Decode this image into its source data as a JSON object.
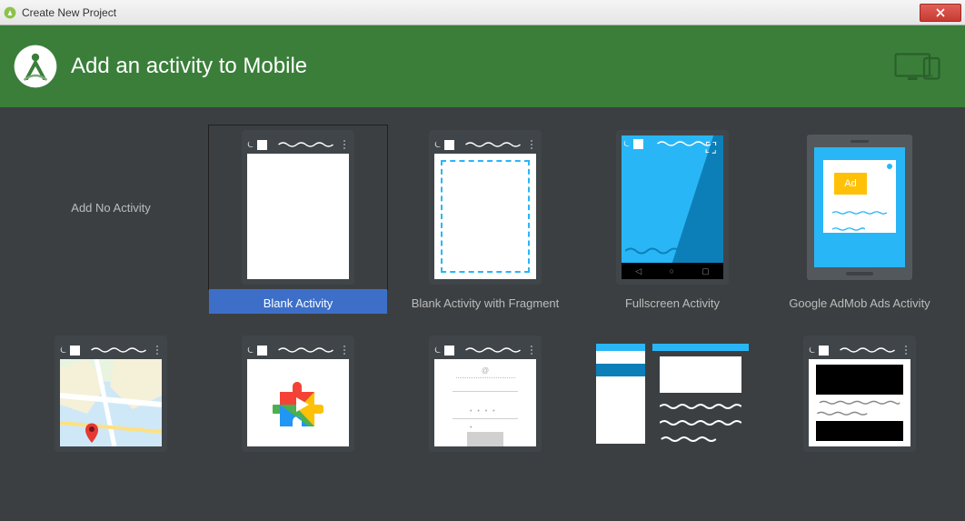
{
  "window": {
    "title": "Create New Project"
  },
  "header": {
    "title": "Add an activity to Mobile"
  },
  "templates": [
    {
      "label": "Add No Activity"
    },
    {
      "label": "Blank Activity"
    },
    {
      "label": "Blank Activity with Fragment"
    },
    {
      "label": "Fullscreen Activity"
    },
    {
      "label": "Google AdMob Ads Activity",
      "ad_text": "Ad"
    }
  ]
}
